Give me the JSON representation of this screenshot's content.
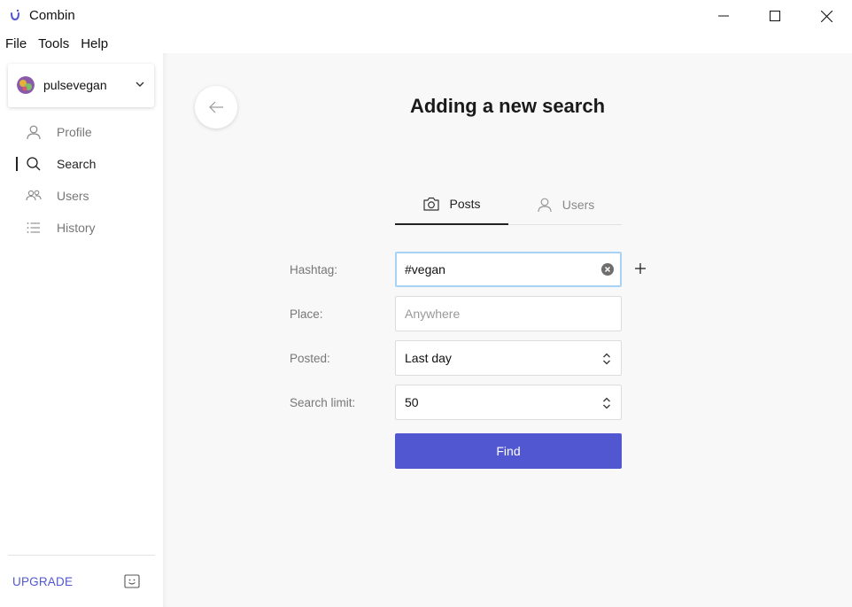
{
  "window": {
    "title": "Combin",
    "brand_color": "#5157d1"
  },
  "menu": [
    "File",
    "Tools",
    "Help"
  ],
  "sidebar": {
    "account": {
      "username": "pulsevegan",
      "avatar_icon": "avatar"
    },
    "items": [
      {
        "label": "Profile",
        "icon": "person-icon",
        "active": false
      },
      {
        "label": "Search",
        "icon": "search-icon",
        "active": true
      },
      {
        "label": "Users",
        "icon": "users-icon",
        "active": false
      },
      {
        "label": "History",
        "icon": "list-icon",
        "active": false
      }
    ],
    "upgrade_label": "UPGRADE",
    "footer_icon": "smile-icon"
  },
  "main": {
    "title": "Adding a new search",
    "tabs": [
      {
        "label": "Posts",
        "icon": "camera-icon",
        "active": true
      },
      {
        "label": "Users",
        "icon": "person-icon",
        "active": false
      }
    ],
    "form": {
      "hashtag": {
        "label": "Hashtag:",
        "value": "#vegan"
      },
      "place": {
        "label": "Place:",
        "placeholder": "Anywhere",
        "value": ""
      },
      "posted": {
        "label": "Posted:",
        "value": "Last day"
      },
      "search_limit": {
        "label": "Search limit:",
        "value": "50"
      }
    },
    "find_label": "Find"
  }
}
